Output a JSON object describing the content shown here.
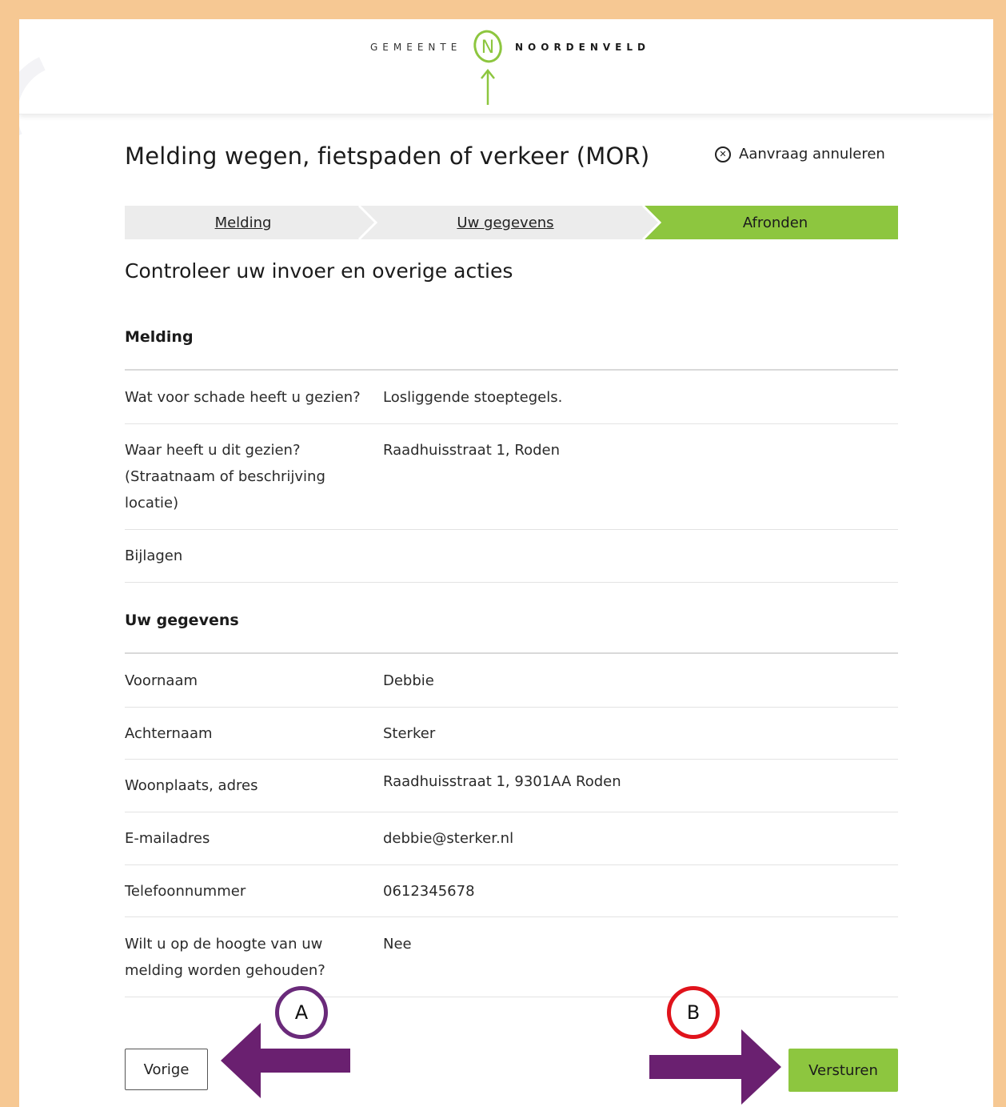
{
  "header": {
    "logo_left": "GEMEENTE",
    "logo_right": "NOORDENVELD",
    "logo_letter": "N"
  },
  "page": {
    "title": "Melding wegen, fietspaden of verkeer (MOR)",
    "cancel_label": "Aanvraag annuleren",
    "subtitle": "Controleer uw invoer en overige acties"
  },
  "steps": [
    {
      "label": "Melding",
      "state": "done"
    },
    {
      "label": "Uw gegevens",
      "state": "done"
    },
    {
      "label": "Afronden",
      "state": "active"
    }
  ],
  "sections": {
    "melding": {
      "heading": "Melding",
      "rows": [
        {
          "q": "Wat voor schade heeft u gezien?",
          "a": "Losliggende stoeptegels."
        },
        {
          "q": "Waar heeft u dit gezien? (Straatnaam of beschrijving locatie)",
          "a": "Raadhuisstraat 1, Roden"
        },
        {
          "q": "Bijlagen",
          "a": ""
        }
      ]
    },
    "gegevens": {
      "heading": "Uw gegevens",
      "rows": [
        {
          "q": "Voornaam",
          "a": "Debbie"
        },
        {
          "q": "Achternaam",
          "a": "Sterker"
        },
        {
          "q": "Woonplaats, adres",
          "a": "Raadhuisstraat 1, 9301AA Roden"
        },
        {
          "q": "E-mailadres",
          "a": "debbie@sterker.nl"
        },
        {
          "q": "Telefoonnummer",
          "a": "0612345678"
        },
        {
          "q": "Wilt u op de hoogte van uw melding worden gehouden?",
          "a": "Nee"
        }
      ]
    }
  },
  "buttons": {
    "prev": "Vorige",
    "send": "Versturen"
  },
  "annotations": {
    "a": "A",
    "b": "B"
  },
  "colors": {
    "frame": "#f6c893",
    "accent_green": "#8dc63f",
    "step_grey": "#ececec",
    "arrow_purple": "#6a2070",
    "circle_a": "#6a2a7a",
    "circle_b": "#e0131b"
  },
  "icons": {
    "cancel": "circle-x-icon",
    "logo": "noordenveld-logo-icon",
    "arrow_left": "arrow-left-icon",
    "arrow_right": "arrow-right-icon"
  }
}
